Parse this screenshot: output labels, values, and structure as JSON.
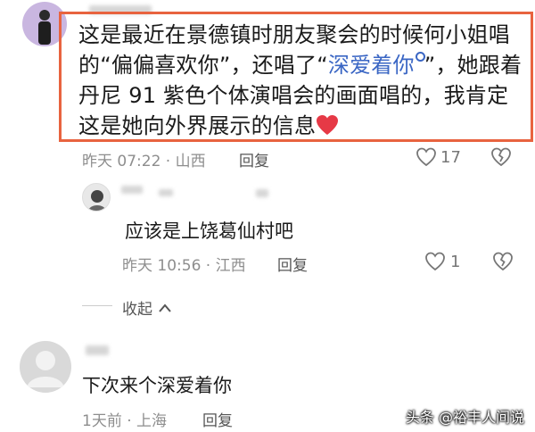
{
  "comment1": {
    "text_part1": "这是最近在景德镇时朋友聚会的时候何小姐唱的“偏偏喜欢你”，还唱了“",
    "link_text": "深爱着你",
    "text_part2": "”，她跟着丹尼 91 紫色个体演唱会的画面唱的，我肯定这是她向外界展示的信息",
    "meta": "昨天 07:22 · 山西",
    "reply_label": "回复",
    "like_count": "17",
    "heart_color": "#e63946",
    "highlight_color": "#e8633f"
  },
  "reply1": {
    "text": "应该是上饶葛仙村吧",
    "meta": "昨天 10:56 · 江西",
    "reply_label": "回复",
    "like_count": "1"
  },
  "collapse_label": "收起",
  "comment2": {
    "text": "下次来个深爱着你",
    "meta": "1天前 · 上海",
    "reply_label": "回复"
  },
  "watermark": "头条 @裕丰人间说"
}
